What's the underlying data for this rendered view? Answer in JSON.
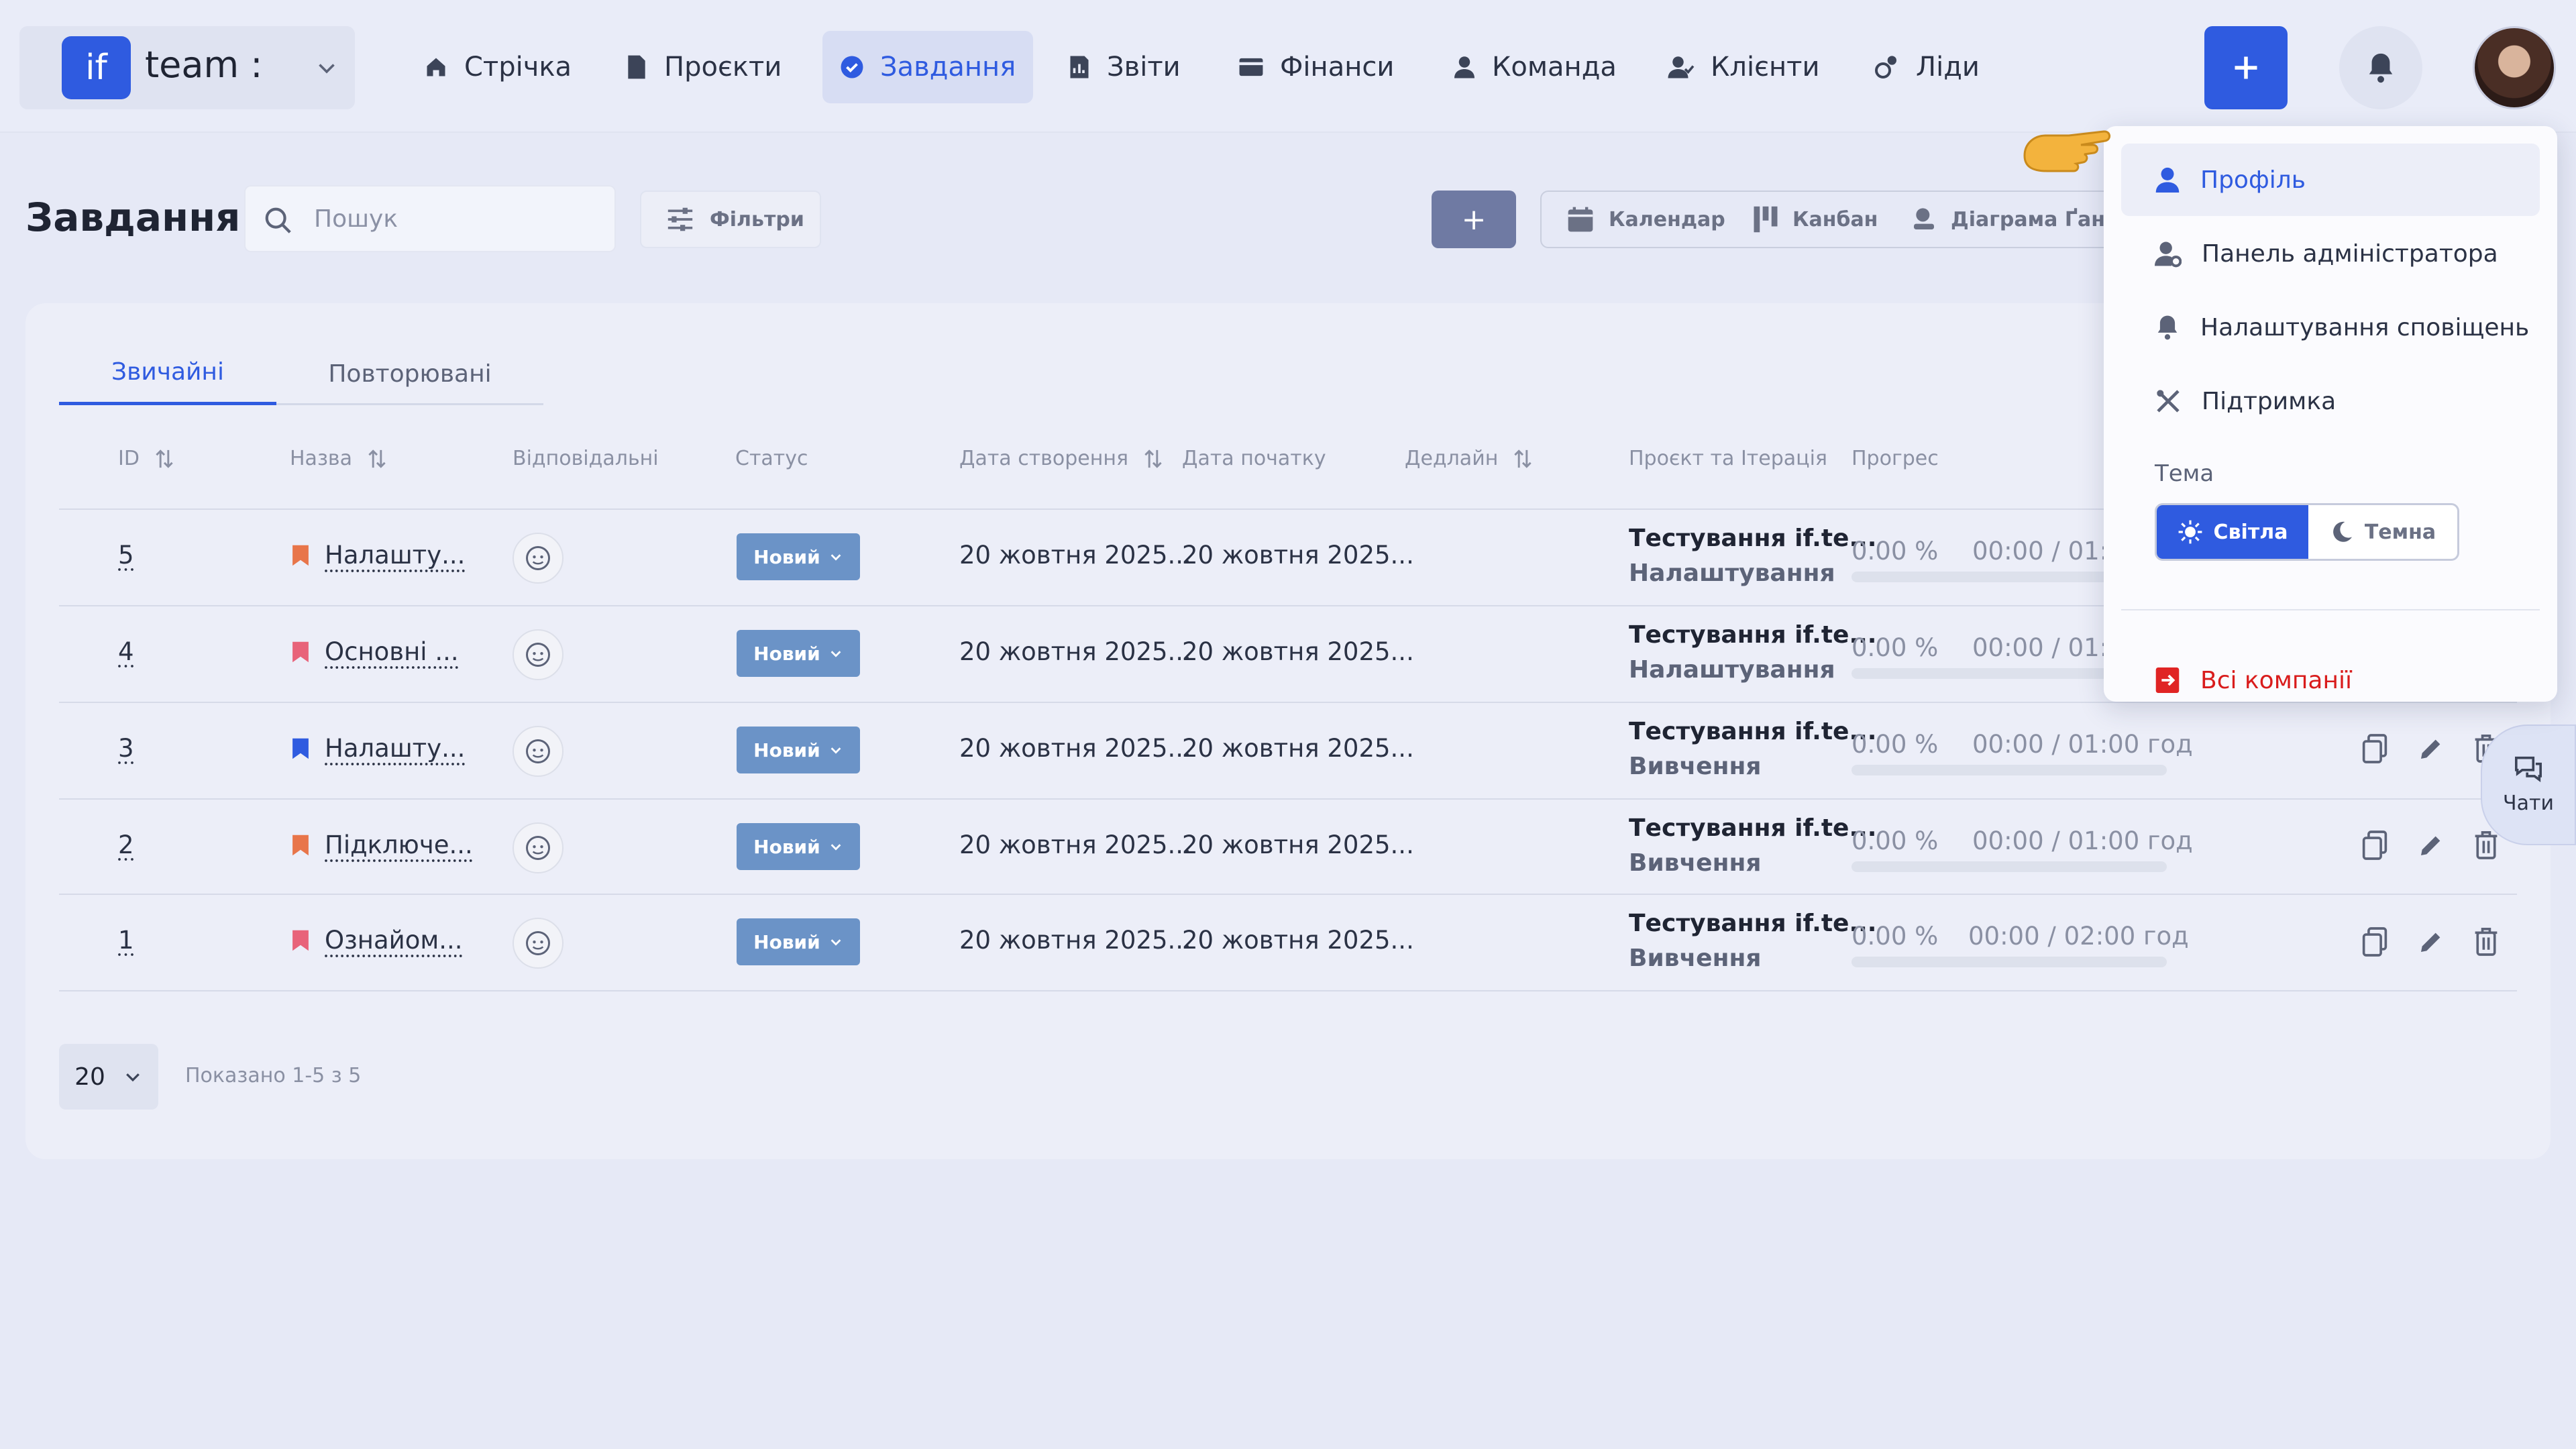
{
  "brand": {
    "logo": "if",
    "name": "team :"
  },
  "nav": [
    {
      "label": "Стрічка",
      "icon": "home-icon"
    },
    {
      "label": "Проєкти",
      "icon": "document-icon"
    },
    {
      "label": "Завдання",
      "icon": "check-circle-icon",
      "active": true
    },
    {
      "label": "Звіти",
      "icon": "report-icon"
    },
    {
      "label": "Фінанси",
      "icon": "wallet-icon"
    },
    {
      "label": "Команда",
      "icon": "person-icon"
    },
    {
      "label": "Клієнти",
      "icon": "clients-icon"
    },
    {
      "label": "Ліди",
      "icon": "leads-icon"
    }
  ],
  "header": {
    "title": "Завдання",
    "search_placeholder": "Пошук",
    "filters_label": "Фільтри",
    "add_label": "+",
    "views": [
      "Календар",
      "Канбан",
      "Діаграма Ґанта"
    ]
  },
  "tabs": [
    "Звичайні",
    "Повторювані"
  ],
  "columns": {
    "id": "ID",
    "name": "Назва",
    "assignees": "Відповідальні",
    "status": "Статус",
    "created": "Дата створення",
    "start": "Дата початку",
    "deadline": "Дедлайн",
    "project": "Проєкт та Ітерація",
    "progress": "Прогрес"
  },
  "rows": [
    {
      "id": "5",
      "name": "Налашту...",
      "flag_color": "#e8754a",
      "status": "Новий",
      "created": "20 жовтня 2025...",
      "start": "20 жовтня 2025...",
      "project": "Тестування if.te...",
      "iteration": "Налаштування",
      "percent": "0.00 %",
      "time": "00:00 / 01:00 год"
    },
    {
      "id": "4",
      "name": "Основні ...",
      "flag_color": "#e8637a",
      "status": "Новий",
      "created": "20 жовтня 2025...",
      "start": "20 жовтня 2025...",
      "project": "Тестування if.te...",
      "iteration": "Налаштування",
      "percent": "0.00 %",
      "time": "00:00 / 01:00 год"
    },
    {
      "id": "3",
      "name": "Налашту...",
      "flag_color": "#2f5be0",
      "status": "Новий",
      "created": "20 жовтня 2025...",
      "start": "20 жовтня 2025...",
      "project": "Тестування if.te...",
      "iteration": "Вивчення",
      "percent": "0.00 %",
      "time": "00:00 / 01:00 год"
    },
    {
      "id": "2",
      "name": "Підключе...",
      "flag_color": "#e8754a",
      "status": "Новий",
      "created": "20 жовтня 2025...",
      "start": "20 жовтня 2025...",
      "project": "Тестування if.te...",
      "iteration": "Вивчення",
      "percent": "0.00 %",
      "time": "00:00 / 01:00 год"
    },
    {
      "id": "1",
      "name": "Ознайом...",
      "flag_color": "#e8637a",
      "status": "Новий",
      "created": "20 жовтня 2025...",
      "start": "20 жовтня 2025...",
      "project": "Тестування if.te...",
      "iteration": "Вивчення",
      "percent": "0.00 %",
      "time": "00:00 / 02:00 год"
    }
  ],
  "pager": {
    "page_size": "20",
    "info": "Показано 1-5 з 5"
  },
  "dropdown": {
    "items": [
      "Профіль",
      "Панель адміністратора",
      "Налаштування сповіщень",
      "Підтримка"
    ],
    "theme_label": "Тема",
    "theme_light": "Світла",
    "theme_dark": "Темна",
    "companies": "Всі компанії"
  },
  "chat": {
    "label": "Чати"
  },
  "colors": {
    "accent": "#2f5be0",
    "status": "#6b93c7",
    "danger": "#e02424"
  }
}
